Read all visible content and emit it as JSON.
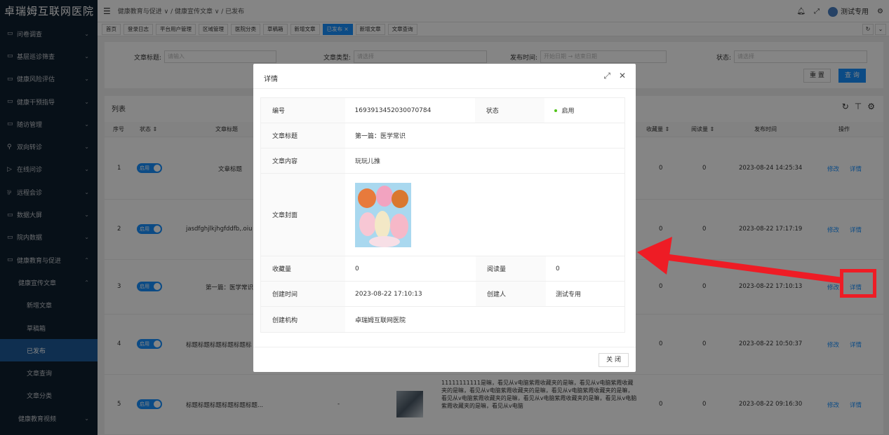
{
  "app": {
    "title": "卓瑞姆互联网医院"
  },
  "sidebar": {
    "items": [
      {
        "icon": "▭",
        "label": "问卷调查",
        "chev": "⌄"
      },
      {
        "icon": "▭",
        "label": "基层巡诊筛查",
        "chev": "⌄"
      },
      {
        "icon": "▭",
        "label": "健康风险评估",
        "chev": "⌄"
      },
      {
        "icon": "▭",
        "label": "健康干预指导",
        "chev": "⌄"
      },
      {
        "icon": "▭",
        "label": "随访管理",
        "chev": "⌄"
      },
      {
        "icon": "⚲",
        "label": "双向转诊",
        "chev": "⌄"
      },
      {
        "icon": "▷",
        "label": "在线问诊",
        "chev": "⌄"
      },
      {
        "icon": "⅌",
        "label": "远程会诊",
        "chev": "⌄"
      },
      {
        "icon": "▭",
        "label": "数据大屏",
        "chev": "⌄"
      },
      {
        "icon": "▭",
        "label": "院内数据",
        "chev": "⌄"
      },
      {
        "icon": "▭",
        "label": "健康教育与促进",
        "chev": "⌃"
      }
    ],
    "sub": {
      "label": "健康宣传文章",
      "chev": "⌃"
    },
    "sub2": [
      "新增文章",
      "草稿箱",
      "已发布",
      "文章查询",
      "文章分类"
    ],
    "last": {
      "label": "健康教育视频",
      "chev": "⌄"
    }
  },
  "topbar": {
    "breadcrumb": "健康教育与促进 ∨ / 健康宣传文章 ∨ / 已发布",
    "user": "测试专用"
  },
  "tabs": [
    "首页",
    "登录日志",
    "平台用户管理",
    "区域管理",
    "医院分类",
    "草稿箱",
    "新增文章",
    "已发布 ×",
    "新增文章",
    "文章查询"
  ],
  "search": {
    "title_label": "文章标题:",
    "title_placeholder": "请输入",
    "type_label": "文章类型:",
    "type_placeholder": "请选择",
    "time_label": "发布时间:",
    "start_placeholder": "开始日期",
    "end_placeholder": "结束日期",
    "status_label": "状态:",
    "status_placeholder": "请选择",
    "reset": "重 置",
    "query": "查 询"
  },
  "table": {
    "title": "列表",
    "headers": {
      "idx": "序号",
      "status": "状态 ⇕",
      "title": "文章标题",
      "fav": "收藏量 ⇕",
      "read": "阅读量 ⇕",
      "time": "发布时间",
      "op": "操作"
    },
    "rows": [
      {
        "idx": "1",
        "toggle": "启用",
        "title": "文章标题",
        "fav": "0",
        "read": "0",
        "time": "2023-08-24 14:25:34",
        "edit": "修改",
        "detail": "详情"
      },
      {
        "idx": "2",
        "toggle": "启用",
        "title": "jasdfghjlkjhgfddfb,.oiu",
        "fav": "0",
        "read": "0",
        "time": "2023-08-22 17:17:19",
        "edit": "修改",
        "detail": "详情"
      },
      {
        "idx": "3",
        "toggle": "启用",
        "title": "第一篇：医学常识",
        "fav": "0",
        "read": "0",
        "time": "2023-08-22 17:10:13",
        "edit": "修改",
        "detail": "详情"
      },
      {
        "idx": "4",
        "toggle": "启用",
        "title": "标题标题标题标题标题标",
        "fav": "0",
        "read": "0",
        "time": "2023-08-22 10:50:37",
        "edit": "修改",
        "detail": "详情"
      },
      {
        "idx": "5",
        "toggle": "启用",
        "title": "标题标题标题标题标题标题...",
        "dash": "-",
        "content": "11111111111是嘛，看见从v电脑紫霞收藏夹的是嘛，看见从v电脑紫霞收藏夹的是嘛，看见从v电脑紫霞收藏夹的是嘛，看见从v电脑紫霞收藏夹的是嘛，看见从v电脑紫霞收藏夹的是嘛，看见从v电脑紫霞收藏夹的是嘛，看见从v电脑紫霞收藏夹的是嘛，看见从v电脑",
        "fav": "0",
        "read": "0",
        "time": "2023-08-22 09:16:30",
        "edit": "修改",
        "detail": "详情"
      }
    ]
  },
  "modal": {
    "title": "详情",
    "id_label": "编号",
    "id_value": "1693913452030070784",
    "status_label": "状态",
    "status_value": "启用",
    "title_label": "文章标题",
    "title_value": "第一篇：医学常识",
    "content_label": "文章内容",
    "content_value": "玩玩儿推",
    "cover_label": "文章封面",
    "fav_label": "收藏量",
    "fav_value": "0",
    "read_label": "阅读量",
    "read_value": "0",
    "created_label": "创建时间",
    "created_value": "2023-08-22 17:10:13",
    "creator_label": "创建人",
    "creator_value": "测试专用",
    "org_label": "创建机构",
    "org_value": "卓瑞姆互联网医院",
    "close": "关 闭"
  },
  "colors": {
    "accent": "#1890ff",
    "sidebar": "#0f1f2e",
    "annotation": "#ee1c25"
  }
}
